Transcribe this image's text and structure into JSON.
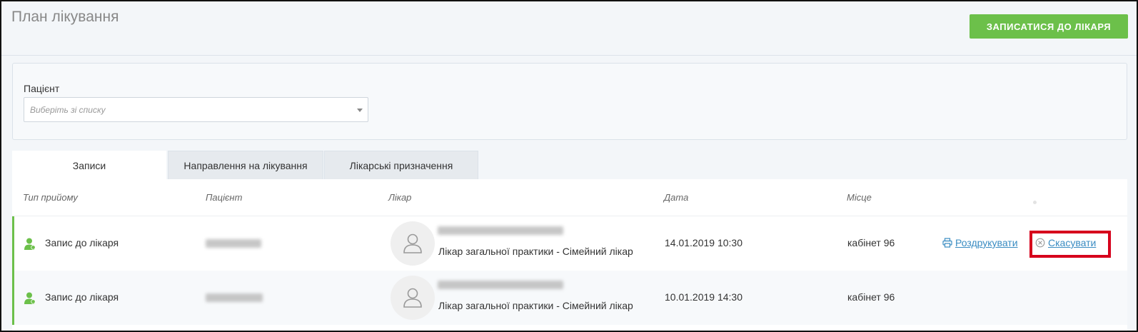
{
  "header": {
    "title": "План лікування",
    "book_button": "ЗАПИСАТИСЯ ДО ЛІКАРЯ"
  },
  "filter": {
    "patient_label": "Пацієнт",
    "patient_placeholder": "Виберіть зі списку"
  },
  "tabs": [
    {
      "label": "Записи",
      "active": true
    },
    {
      "label": "Направлення на лікування",
      "active": false
    },
    {
      "label": "Лікарські призначення",
      "active": false
    }
  ],
  "table": {
    "columns": [
      "Тип прийому",
      "Пацієнт",
      "Лікар",
      "Дата",
      "Місце"
    ],
    "rows": [
      {
        "type": "Запис до лікаря",
        "doctor_role": "Лікар загальної практики - Сімейний лікар",
        "date": "14.01.2019 10:30",
        "place": "кабінет 96",
        "actions": {
          "print": "Роздрукувати",
          "cancel": "Скасувати"
        }
      },
      {
        "type": "Запис до лікаря",
        "doctor_role": "Лікар загальної практики - Сімейний лікар",
        "date": "10.01.2019 14:30",
        "place": "кабінет 96"
      }
    ]
  },
  "colors": {
    "accent": "#6cc04a",
    "link": "#3a8cc2",
    "highlight": "#d6001c"
  }
}
